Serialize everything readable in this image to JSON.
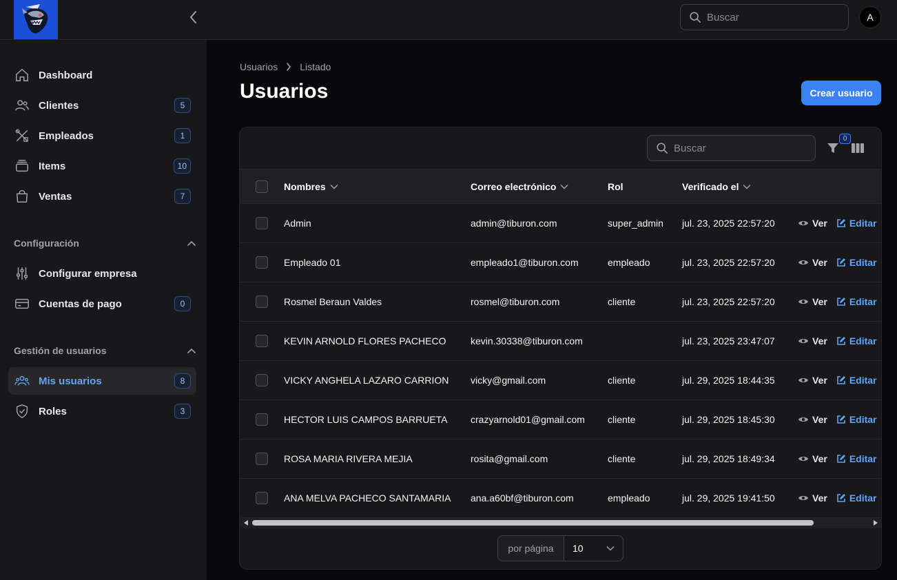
{
  "topbar": {
    "search_placeholder": "Buscar",
    "avatar_initial": "A"
  },
  "sidebar": {
    "items": [
      {
        "label": "Dashboard",
        "badge": ""
      },
      {
        "label": "Clientes",
        "badge": "5"
      },
      {
        "label": "Empleados",
        "badge": "1"
      },
      {
        "label": "Items",
        "badge": "10"
      },
      {
        "label": "Ventas",
        "badge": "7"
      }
    ],
    "group_config": {
      "label": "Configuración",
      "items": [
        {
          "label": "Configurar empresa",
          "badge": ""
        },
        {
          "label": "Cuentas de pago",
          "badge": "0"
        }
      ]
    },
    "group_users": {
      "label": "Gestión de usuarios",
      "items": [
        {
          "label": "Mis usuarios",
          "badge": "8"
        },
        {
          "label": "Roles",
          "badge": "3"
        }
      ]
    }
  },
  "breadcrumb": {
    "parent": "Usuarios",
    "current": "Listado"
  },
  "page": {
    "title": "Usuarios",
    "create_label": "Crear usuario"
  },
  "table": {
    "search_placeholder": "Buscar",
    "filter_count": "0",
    "columns": {
      "name": "Nombres",
      "email": "Correo electrónico",
      "role": "Rol",
      "verified": "Verificado el"
    },
    "action_view": "Ver",
    "action_edit": "Editar",
    "rows": [
      {
        "name": "Admin",
        "email": "admin@tiburon.com",
        "role": "super_admin",
        "verified": "jul. 23, 2025 22:57:20"
      },
      {
        "name": "Empleado 01",
        "email": "empleado1@tiburon.com",
        "role": "empleado",
        "verified": "jul. 23, 2025 22:57:20"
      },
      {
        "name": "Rosmel Beraun Valdes",
        "email": "rosmel@tiburon.com",
        "role": "cliente",
        "verified": "jul. 23, 2025 22:57:20"
      },
      {
        "name": "KEVIN ARNOLD FLORES PACHECO",
        "email": "kevin.30338@tiburon.com",
        "role": "",
        "verified": "jul. 23, 2025 23:47:07"
      },
      {
        "name": "VICKY ANGHELA LAZARO CARRION",
        "email": "vicky@gmail.com",
        "role": "cliente",
        "verified": "jul. 29, 2025 18:44:35"
      },
      {
        "name": "HECTOR LUIS CAMPOS BARRUETA",
        "email": "crazyarnold01@gmail.com",
        "role": "cliente",
        "verified": "jul. 29, 2025 18:45:30"
      },
      {
        "name": "ROSA MARIA RIVERA MEJIA",
        "email": "rosita@gmail.com",
        "role": "cliente",
        "verified": "jul. 29, 2025 18:49:34"
      },
      {
        "name": "ANA MELVA PACHECO SANTAMARIA",
        "email": "ana.a60bf@tiburon.com",
        "role": "empleado",
        "verified": "jul. 29, 2025 19:41:50"
      }
    ]
  },
  "pagination": {
    "per_page_label": "por página",
    "per_page_value": "10"
  },
  "colors": {
    "accent": "#3b82f6",
    "link": "#60a5fa",
    "surface": "#18181b",
    "background": "#09090b"
  }
}
